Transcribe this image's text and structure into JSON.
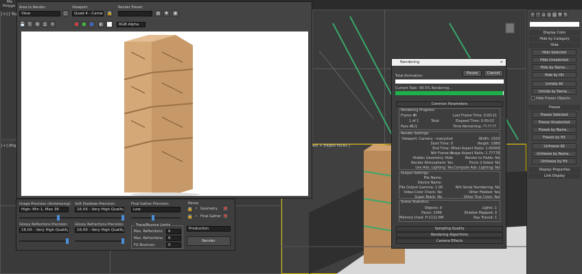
{
  "app": {
    "menu_top": "Mo",
    "menu_sub": "Polygo",
    "viewport_topleft": "[+] [ Top ]",
    "viewport_left": "[+] [Right]",
    "viewport_persp_label": "ats + Edged Faces ]"
  },
  "frame_window": {
    "area_label": "Area to Render:",
    "area_value": "View",
    "viewport_label": "Viewport:",
    "viewport_value": "Quad 4 - Camera",
    "preset_label": "Render Preset:",
    "preset_value": "",
    "channel_value": "RGB Alpha"
  },
  "render_controls": {
    "img_prec_label": "Image Precision (Antialiasing):",
    "img_prec_value": "High: Min 1, Max 36",
    "soft_shadow_label": "Soft Shadows Precision:",
    "soft_shadow_value": "16.0X - Very High Quality",
    "final_gather_label": "Final Gather Precision:",
    "final_gather_value": "Low",
    "reuse_label": "Reuse",
    "geometry_label": "Geometry",
    "final_gather_check": "Final Gather",
    "glossy_refl_label": "Glossy Reflections Precision:",
    "glossy_refl_value": "16.0X - Very High Quality",
    "glossy_refr_label": "Glossy Refractions Precision:",
    "glossy_refr_value": "16.0X - Very High Quality",
    "trace_label": "Trace/Bounce Limits",
    "max_refl_label": "Max. Reflections:",
    "max_refl_value": "6",
    "max_refr_label": "Max. Refractions:",
    "max_refr_value": "6",
    "fg_bounce_label": "FG Bounces:",
    "fg_bounce_value": "0",
    "production_value": "Production",
    "render_button": "Render"
  },
  "rendering": {
    "title": "Rendering",
    "pause": "Pause",
    "cancel": "Cancel",
    "total_anim": "Total Animation:",
    "current_task_label": "Current Task:",
    "current_task_value": "99.5%  Rendering...",
    "progress": 0.995,
    "common_params": "Common Parameters",
    "progress_head": "Rendering Progress:",
    "frame_label": "Frame #",
    "frame_value": "0",
    "of_value": "1 of 1",
    "total": "Total",
    "pass_label": "Pass #",
    "pass_value": "1/1",
    "last_frame": "Last Frame Time: 0:00:21",
    "elapsed": "Elapsed Time: 0:00:02",
    "remaining": "Time Remaining: ??:??:??",
    "settings_head": "Render Settings:",
    "settings_left": [
      "Viewport: Camera - manyshot",
      "Start Time: 0",
      "End Time: 0",
      "Nth Frame: 1",
      "Hidden Geometry: Hide",
      "Render Atmosphere: Yes",
      "Use Adv. Lighting: Yes"
    ],
    "settings_right": [
      "Width: 1920",
      "Height: 1080",
      "Pixel Aspect Ratio: 1.00000",
      "Image Aspect Ratio: 1.77778",
      "Render to Fields: No",
      "Force 2-Sided: No",
      "Compute Adv. Lighting: No"
    ],
    "output_head": "Output Settings:",
    "output_left": [
      "File Name:",
      "Device Name:",
      "File Output Gamma: 1.00",
      "Video Color Check: No",
      "Super Black: No"
    ],
    "output_right": [
      "Nth Serial Numbering: No",
      "Other Fielded: Yes",
      "Other True Color: Yes"
    ],
    "scene_head": "Scene Statistics:",
    "scene_left": [
      "Objects: 9",
      "Faces: 2346",
      "Memory Used: P:1111.6M"
    ],
    "scene_right": [
      "Lights: 1",
      "Shadow Mapped: 0",
      "Ray Traced: 1"
    ],
    "rollouts": [
      "Sampling Quality",
      "Rendering Algorithms",
      "Camera Effects"
    ]
  },
  "command_panel": {
    "display_color": "Display Color",
    "hide_by_category": "Hide by Category",
    "hide": "Hide",
    "buttons_hide": [
      "Hide Selected",
      "Hide Unselected",
      "Hide by Name...",
      "Hide by Hit",
      "Unhide All",
      "Unhide by Name..."
    ],
    "hide_frozen": "Hide Frozen Objects",
    "freeze": "Freeze",
    "buttons_freeze": [
      "Freeze Selected",
      "Freeze Unselected",
      "Freeze by Name...",
      "Freeze by Hit",
      "Unfreeze All",
      "Unfreeze by Name...",
      "Unfreeze by Hit"
    ],
    "display_props": "Display Properties",
    "link_display": "Link Display"
  }
}
